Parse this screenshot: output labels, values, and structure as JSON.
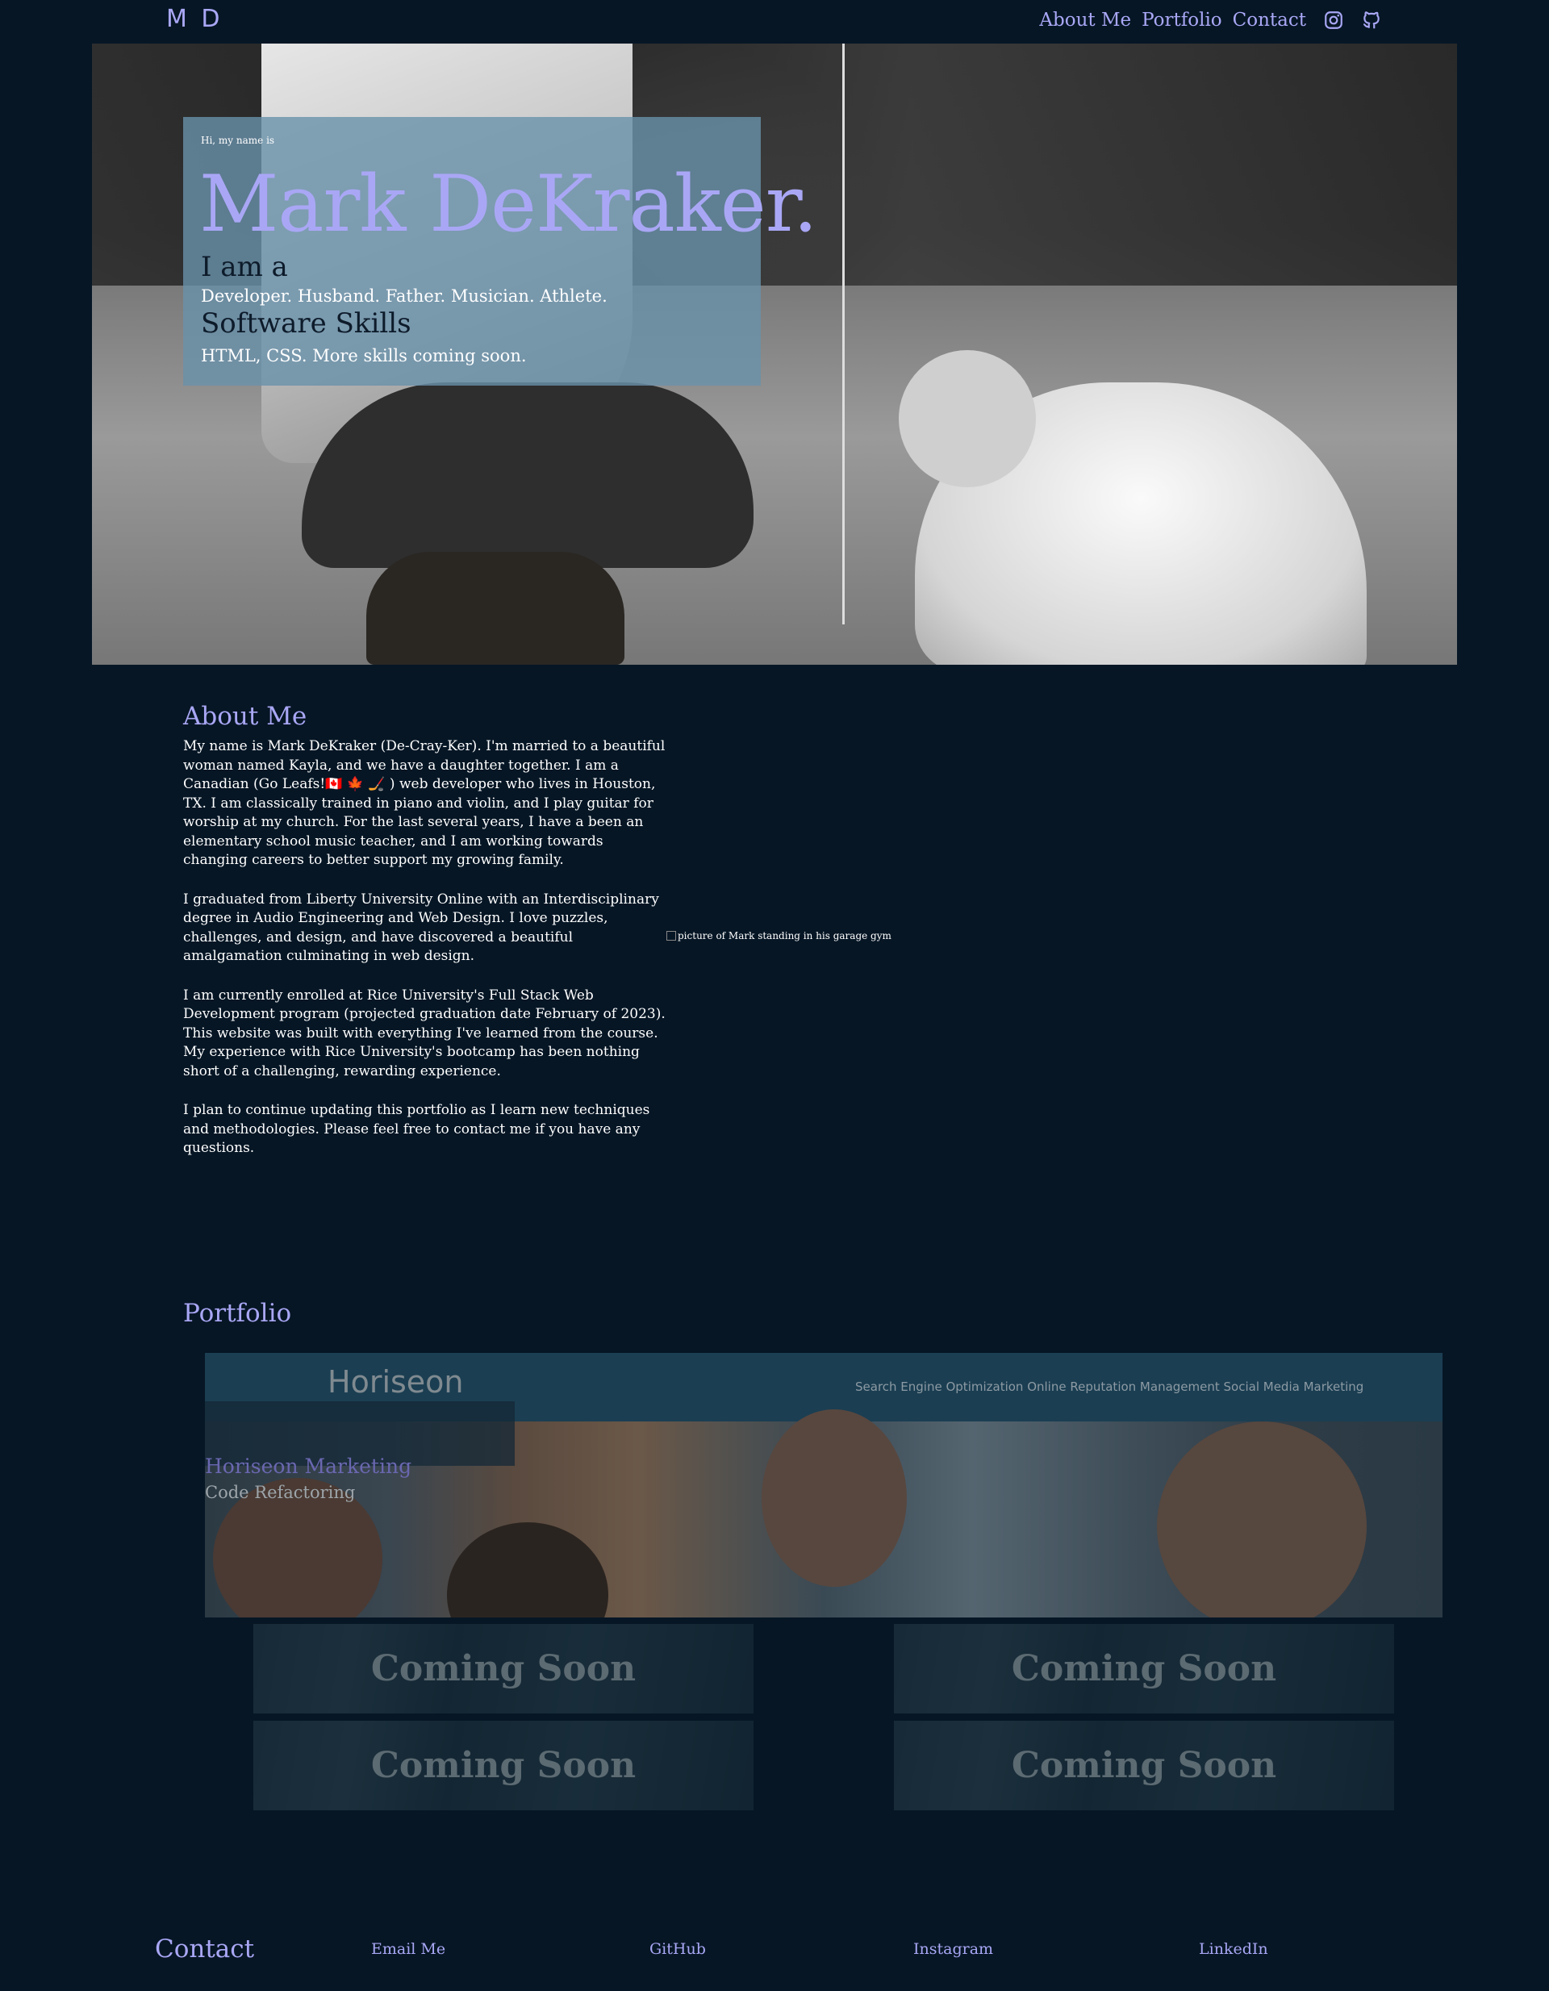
{
  "header": {
    "logo": "M D",
    "nav": [
      "About Me",
      "Portfolio",
      "Contact"
    ],
    "icons": [
      "instagram-icon",
      "github-icon"
    ]
  },
  "hero": {
    "greeting": "Hi, my name is",
    "name": "Mark DeKraker.",
    "i_am_heading": "I am a",
    "roles": "Developer. Husband. Father. Musician. Athlete.",
    "skills_heading": "Software Skills",
    "skills": "HTML, CSS. More skills coming soon."
  },
  "about": {
    "title": "About Me",
    "paragraphs": [
      "My name is Mark DeKraker (De-Cray-Ker). I'm married to a beautiful woman named Kayla, and we have a daughter together. I am a Canadian (Go Leafs!🇨🇦 🍁 🏒 ) web developer who lives in Houston, TX. I am classically trained in piano and violin, and I play guitar for worship at my church. For the last several years, I have a been an elementary school music teacher, and I am working towards changing careers to better support my growing family.",
      "I graduated from Liberty University Online with an Interdisciplinary degree in Audio Engineering and Web Design. I love puzzles, challenges, and design, and have discovered a beautiful amalgamation culminating in web design.",
      "I am currently enrolled at Rice University's Full Stack Web Development program (projected graduation date February of 2023). This website was built with everything I've learned from the course. My experience with Rice University's bootcamp has been nothing short of a challenging, rewarding experience.",
      "I plan to continue updating this portfolio as I learn new techniques and methodologies. Please feel free to contact me if you have any questions."
    ],
    "image_alt": "picture of Mark standing in his garage gym"
  },
  "portfolio": {
    "title": "Portfolio",
    "feature": {
      "site_logo": "Horiseon",
      "site_nav": "Search Engine Optimization   Online Reputation Management   Social Media Marketing",
      "title": "Horiseon Marketing",
      "subtitle": "Code Refactoring"
    },
    "coming_soon": [
      "Coming Soon",
      "Coming Soon",
      "Coming Soon",
      "Coming Soon"
    ]
  },
  "contact": {
    "title": "Contact",
    "links": [
      "Email Me",
      "GitHub",
      "Instagram",
      "LinkedIn"
    ]
  },
  "colors": {
    "background": "#061625",
    "accent": "#a9a7f5",
    "intro_box": "#6991aa"
  }
}
